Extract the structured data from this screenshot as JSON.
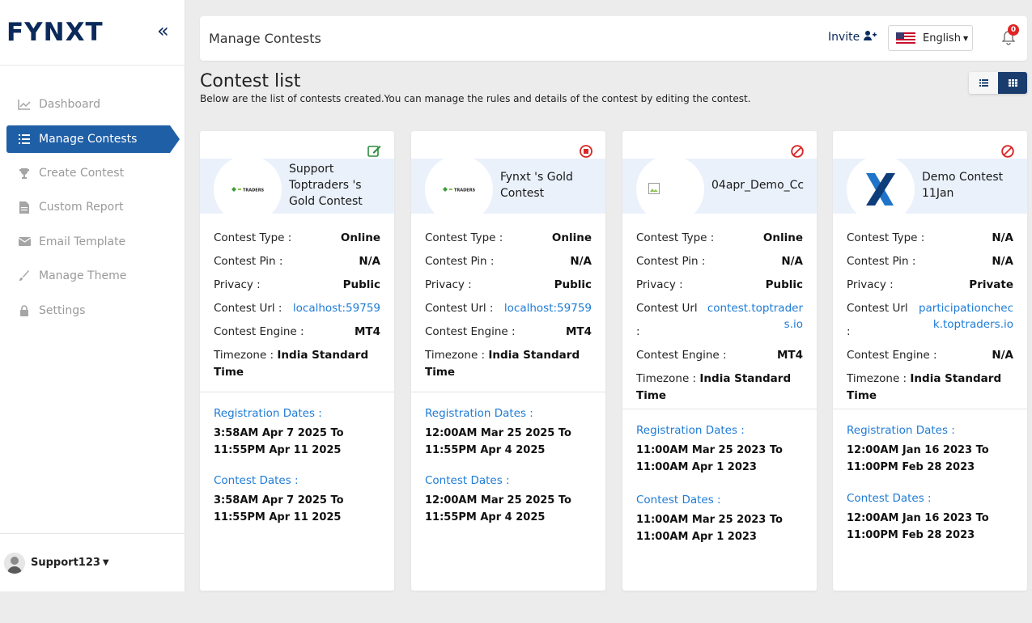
{
  "brand": {
    "logo": "FYNXT"
  },
  "sidebar": {
    "items": [
      {
        "label": "Dashboard",
        "icon": "chart-line-icon"
      },
      {
        "label": "Manage Contests",
        "icon": "list-icon"
      },
      {
        "label": "Create Contest",
        "icon": "trophy-icon"
      },
      {
        "label": "Custom Report",
        "icon": "file-icon"
      },
      {
        "label": "Email Template",
        "icon": "envelope-icon"
      },
      {
        "label": "Manage Theme",
        "icon": "brush-icon"
      },
      {
        "label": "Settings",
        "icon": "lock-icon"
      }
    ],
    "user": "Support123"
  },
  "header": {
    "title": "Manage Contests",
    "invite": "Invite",
    "language": "English",
    "notifications": "0"
  },
  "page": {
    "title": "Contest list",
    "subtitle": "Below are the list of contests created.You can manage the rules and details of the contest by editing the contest."
  },
  "labels": {
    "type": "Contest Type :",
    "pin": "Contest Pin :",
    "privacy": "Privacy :",
    "url": "Contest Url :",
    "engine": "Contest Engine :",
    "timezone": "Timezone :",
    "reg": "Registration Dates :",
    "contest": "Contest Dates :",
    "to": "To"
  },
  "cards": [
    {
      "name": "Support Toptraders 's Gold Contest",
      "type": "Online",
      "pin": "N/A",
      "privacy": "Public",
      "url": "localhost:59759",
      "engine": "MT4",
      "timezone": "India Standard Time",
      "reg_start": "3:58AM Apr 7 2025",
      "reg_end": "11:55PM Apr 11 2025",
      "c_start": "3:58AM Apr 7 2025",
      "c_end": "11:55PM Apr 11 2025"
    },
    {
      "name": "Fynxt 's Gold Contest",
      "type": "Online",
      "pin": "N/A",
      "privacy": "Public",
      "url": "localhost:59759",
      "engine": "MT4",
      "timezone": "India Standard Time",
      "reg_start": "12:00AM Mar 25 2025",
      "reg_end": "11:55PM Apr 4 2025",
      "c_start": "12:00AM Mar 25 2025",
      "c_end": "11:55PM Apr 4 2025"
    },
    {
      "name": "04apr_Demo_Cc",
      "type": "Online",
      "pin": "N/A",
      "privacy": "Public",
      "url": "contest.toptraders.io",
      "engine": "MT4",
      "timezone": "India Standard Time",
      "reg_start": "11:00AM Mar 25 2023",
      "reg_end": "11:00AM Apr 1 2023",
      "c_start": "11:00AM Mar 25 2023",
      "c_end": "11:00AM Apr 1 2023"
    },
    {
      "name": "Demo Contest 11Jan",
      "type": "N/A",
      "pin": "N/A",
      "privacy": "Private",
      "url": "participationcheck.toptraders.io",
      "engine": "N/A",
      "timezone": "India Standard Time",
      "reg_start": "12:00AM Jan 16 2023",
      "reg_end": "11:00PM Feb 28 2023",
      "c_start": "12:00AM Jan 16 2023",
      "c_end": "11:00PM Feb 28 2023"
    }
  ]
}
